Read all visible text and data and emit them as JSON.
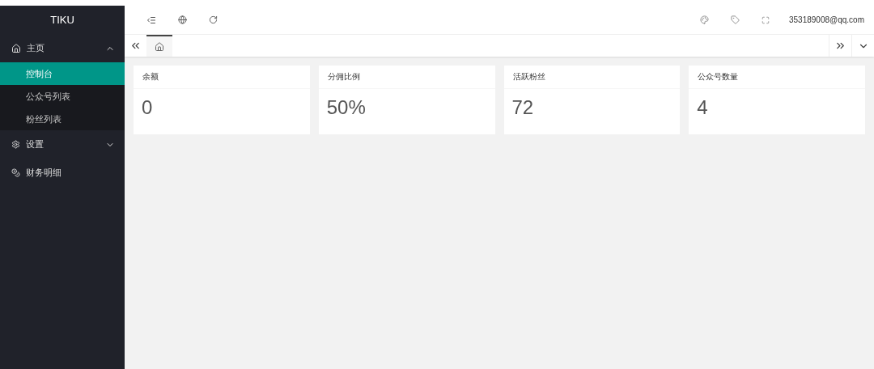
{
  "sidebar": {
    "logo": "TIKU",
    "items": [
      {
        "kind": "home",
        "label": "主页",
        "expanded": true,
        "children": [
          {
            "label": "控制台",
            "selected": true
          },
          {
            "label": "公众号列表",
            "selected": false
          },
          {
            "label": "粉丝列表",
            "selected": false
          }
        ]
      },
      {
        "kind": "settings",
        "label": "设置",
        "expanded": false
      },
      {
        "kind": "finance",
        "label": "财务明细"
      }
    ]
  },
  "header": {
    "user": "353189008@qq.com"
  },
  "tabs": [
    {
      "kind": "home",
      "selected": true
    }
  ],
  "cards": [
    {
      "title": "余额",
      "value": "0"
    },
    {
      "title": "分佣比例",
      "value": "50%"
    },
    {
      "title": "活跃粉丝",
      "value": "72"
    },
    {
      "title": "公众号数量",
      "value": "4"
    }
  ]
}
